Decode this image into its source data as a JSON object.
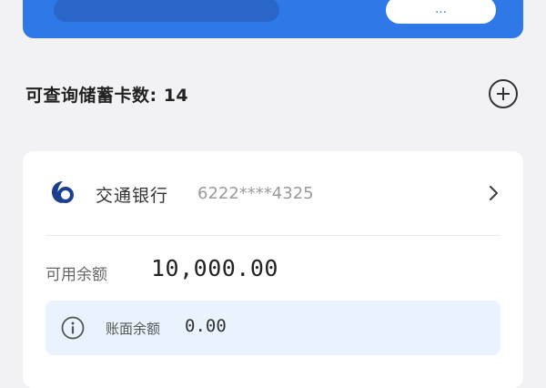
{
  "banner": {
    "note_text": "",
    "button_label": "…"
  },
  "section": {
    "title": "可查询储蓄卡数: 14"
  },
  "card": {
    "bank_name": "交通银行",
    "card_number": "6222****4325",
    "available_label": "可用余额",
    "available_value": "10,000.00",
    "ledger_label": "账面余额",
    "ledger_value": "0.00"
  },
  "icons": {
    "bank_logo": "bank-of-communications-logo",
    "add": "plus-circle-icon",
    "chevron": "chevron-right-icon",
    "info": "info-circle-icon"
  },
  "colors": {
    "banner": "#2f78e8",
    "banner_note": "#2a66c8",
    "info_box": "#eaf3fd",
    "bank_logo": "#1a3f8f"
  }
}
